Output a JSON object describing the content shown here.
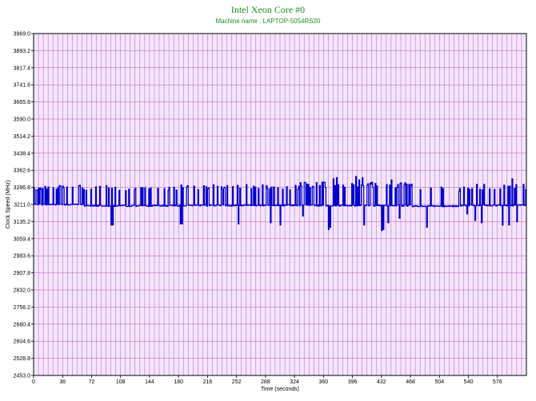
{
  "chart_data": {
    "type": "line",
    "title": "Intel Xeon Core #0",
    "subtitle": "Machine name : LAPTOP-5054RS20",
    "xlabel": "Time (seconds)",
    "ylabel": "Clock Speed (MHz)",
    "xlim": [
      0,
      612
    ],
    "ylim": [
      2453.0,
      3969.0
    ],
    "x_ticks": [
      "0",
      "36",
      "72",
      "108",
      "144",
      "180",
      "216",
      "252",
      "288",
      "324",
      "360",
      "396",
      "432",
      "468",
      "504",
      "540",
      "576"
    ],
    "y_ticks": [
      "2453.0",
      "2528.8",
      "2604.6",
      "2680.4",
      "2756.2",
      "2832.0",
      "2907.8",
      "2983.6",
      "3059.4",
      "3135.2",
      "3211.0",
      "3286.8",
      "3362.6",
      "3438.4",
      "3514.2",
      "3590.0",
      "3665.8",
      "3741.6",
      "3817.4",
      "3893.2",
      "3969.0"
    ],
    "grid": true,
    "colors": {
      "line": "#0000cc",
      "plot_bg": "#f5e6ff",
      "grid": "#b060b0",
      "title": "#1f8f1f"
    },
    "series": [
      {
        "baseline": 3205,
        "segments": [
          {
            "from": 0,
            "to": 62,
            "value": 3211,
            "spike_high": 3300,
            "spike_every": 3
          },
          {
            "from": 62,
            "to": 92,
            "value": 3206,
            "spike_high": 3295,
            "spike_every": 4
          },
          {
            "from": 92,
            "to": 180,
            "value": 3205,
            "spike_high": 3290,
            "spike_every": 6
          },
          {
            "from": 180,
            "to": 330,
            "value": 3207,
            "spike_high": 3300,
            "spike_every": 4
          },
          {
            "from": 330,
            "to": 470,
            "value": 3206,
            "spike_high": 3310,
            "spike_every": 3
          },
          {
            "from": 470,
            "to": 530,
            "value": 3204,
            "spike_high": 3290,
            "spike_every": 6
          },
          {
            "from": 530,
            "to": 612,
            "value": 3207,
            "spike_high": 3300,
            "spike_every": 3
          }
        ],
        "dips": [
          {
            "x": 96,
            "y": 3120
          },
          {
            "x": 98,
            "y": 3120
          },
          {
            "x": 182,
            "y": 3125
          },
          {
            "x": 184,
            "y": 3125
          },
          {
            "x": 254,
            "y": 3125
          },
          {
            "x": 294,
            "y": 3130
          },
          {
            "x": 306,
            "y": 3120
          },
          {
            "x": 334,
            "y": 3160
          },
          {
            "x": 366,
            "y": 3100
          },
          {
            "x": 368,
            "y": 3110
          },
          {
            "x": 400,
            "y": 3160
          },
          {
            "x": 410,
            "y": 3120
          },
          {
            "x": 432,
            "y": 3095
          },
          {
            "x": 434,
            "y": 3100
          },
          {
            "x": 440,
            "y": 3130
          },
          {
            "x": 454,
            "y": 3150
          },
          {
            "x": 488,
            "y": 3110
          },
          {
            "x": 538,
            "y": 3170
          },
          {
            "x": 548,
            "y": 3140
          },
          {
            "x": 556,
            "y": 3130
          },
          {
            "x": 582,
            "y": 3120
          },
          {
            "x": 590,
            "y": 3120
          },
          {
            "x": 594,
            "y": 3120
          },
          {
            "x": 600,
            "y": 3135
          }
        ],
        "peaks": [
          {
            "x": 372,
            "y": 3325
          },
          {
            "x": 376,
            "y": 3330
          },
          {
            "x": 400,
            "y": 3335
          },
          {
            "x": 404,
            "y": 3320
          },
          {
            "x": 408,
            "y": 3330
          },
          {
            "x": 444,
            "y": 3320
          },
          {
            "x": 594,
            "y": 3325
          },
          {
            "x": 608,
            "y": 3300
          }
        ]
      }
    ]
  }
}
